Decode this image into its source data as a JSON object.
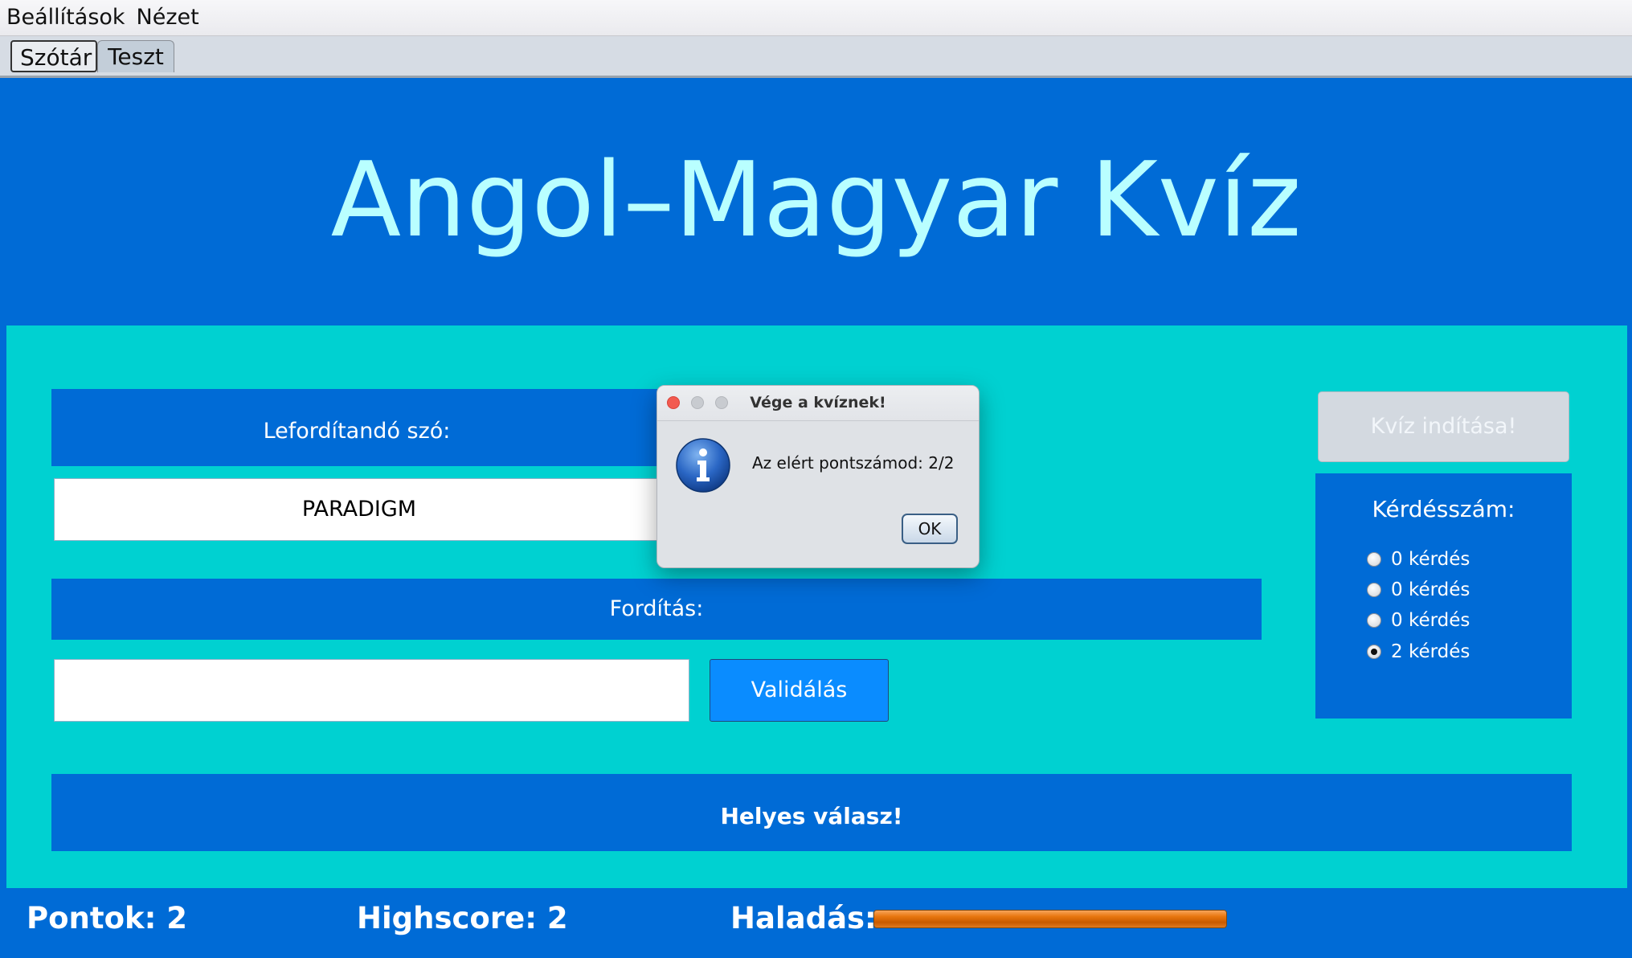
{
  "menubar": {
    "items": [
      "Beállítások",
      "Nézet"
    ]
  },
  "tabs": [
    {
      "label": "Szótár"
    },
    {
      "label": "Teszt"
    }
  ],
  "main": {
    "title": "Angol–Magyar Kvíz",
    "word_label": "Lefordítandó szó:",
    "word_value": "PARADIGM",
    "translation_label": "Fordítás:",
    "translation_value": "",
    "validate_button": "Validálás",
    "feedback": "Helyes válasz!",
    "start_button": "Kvíz indítása!",
    "question_count": {
      "title": "Kérdésszám:",
      "options": [
        {
          "label": "0 kérdés",
          "selected": false
        },
        {
          "label": "0 kérdés",
          "selected": false
        },
        {
          "label": "0 kérdés",
          "selected": false
        },
        {
          "label": "2 kérdés",
          "selected": true
        }
      ]
    }
  },
  "status": {
    "points": "Pontok: 2",
    "highscore": "Highscore: 2",
    "progress_label": "Haladás:",
    "progress": 1.0
  },
  "dialog": {
    "title": "Vége a kvíznek!",
    "message": "Az elért pontszámod: 2/2",
    "ok_label": "OK"
  },
  "colors": {
    "background": "#006bd6",
    "panel": "#00d1d1",
    "title_text": "#b9ffff",
    "validate_button": "#0a8cff",
    "progress_fill": "#e8770f"
  }
}
